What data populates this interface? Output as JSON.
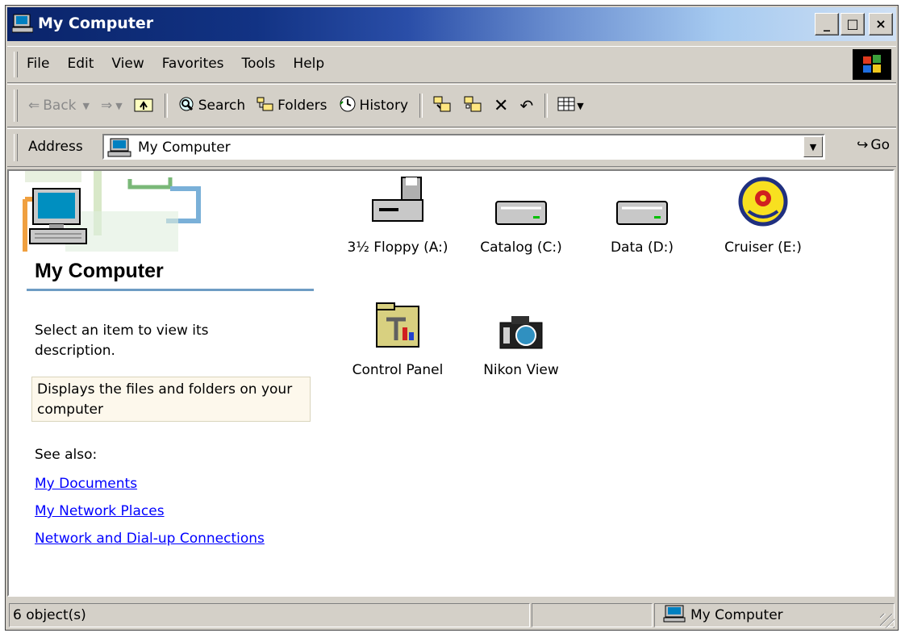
{
  "window": {
    "title": "My Computer"
  },
  "window_buttons": {
    "minimize": "_",
    "maximize": "□",
    "close": "×"
  },
  "menu": [
    "File",
    "Edit",
    "View",
    "Favorites",
    "Tools",
    "Help"
  ],
  "toolbar": {
    "back": "Back",
    "search": "Search",
    "folders": "Folders",
    "history": "History"
  },
  "address": {
    "label": "Address",
    "value": "My Computer",
    "go": "Go"
  },
  "left_panel": {
    "heading": "My Computer",
    "prompt": "Select an item to view its description.",
    "info": "Displays the files and folders on your computer",
    "see_also": "See also:",
    "links": [
      "My Documents",
      "My Network Places",
      "Network and Dial-up Connections"
    ]
  },
  "items": [
    {
      "label": "3½ Floppy (A:)",
      "icon": "floppy-drive-icon"
    },
    {
      "label": "Catalog (C:)",
      "icon": "hard-drive-icon"
    },
    {
      "label": "Data (D:)",
      "icon": "hard-drive-icon"
    },
    {
      "label": "Cruiser (E:)",
      "icon": "cd-drive-icon"
    },
    {
      "label": "Control Panel",
      "icon": "control-panel-icon"
    },
    {
      "label": "Nikon View",
      "icon": "camera-icon"
    }
  ],
  "status": {
    "count": "6 object(s)",
    "zone": "My Computer"
  }
}
